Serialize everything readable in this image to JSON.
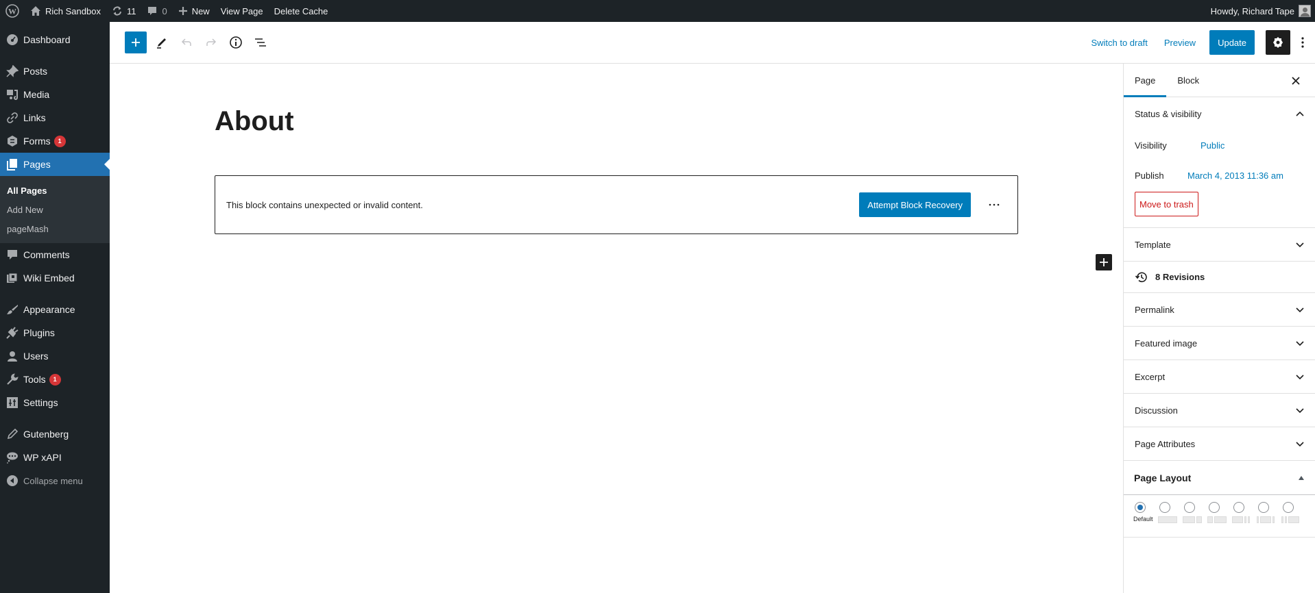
{
  "admin_bar": {
    "site_name": "Rich Sandbox",
    "updates_count": "11",
    "comments_count": "0",
    "new_label": "New",
    "view_page_label": "View Page",
    "delete_cache_label": "Delete Cache",
    "greeting": "Howdy, Richard Tape"
  },
  "sidebar": {
    "items": [
      {
        "label": "Dashboard",
        "icon": "dashboard-icon"
      },
      {
        "label": "Posts",
        "icon": "pin-icon"
      },
      {
        "label": "Media",
        "icon": "media-icon"
      },
      {
        "label": "Links",
        "icon": "link-icon"
      },
      {
        "label": "Forms",
        "icon": "forms-icon",
        "badge": "1"
      },
      {
        "label": "Pages",
        "icon": "pages-icon",
        "active": true
      },
      {
        "label": "Comments",
        "icon": "comment-icon"
      },
      {
        "label": "Wiki Embed",
        "icon": "wiki-icon"
      },
      {
        "label": "Appearance",
        "icon": "brush-icon"
      },
      {
        "label": "Plugins",
        "icon": "plug-icon"
      },
      {
        "label": "Users",
        "icon": "user-icon"
      },
      {
        "label": "Tools",
        "icon": "wrench-icon",
        "badge": "1"
      },
      {
        "label": "Settings",
        "icon": "settings-sliders-icon"
      },
      {
        "label": "Gutenberg",
        "icon": "pencil-icon"
      },
      {
        "label": "WP xAPI",
        "icon": "speech-bubble-icon"
      },
      {
        "label": "Collapse menu",
        "icon": "collapse-icon"
      }
    ],
    "pages_submenu": [
      "All Pages",
      "Add New",
      "pageMash"
    ]
  },
  "toolbar": {
    "switch_to_draft": "Switch to draft",
    "preview": "Preview",
    "update": "Update"
  },
  "editor": {
    "title": "About",
    "warning": "This block contains unexpected or invalid content.",
    "recover_label": "Attempt Block Recovery"
  },
  "panel": {
    "tabs": [
      "Page",
      "Block"
    ],
    "active_tab": "Page",
    "status_title": "Status & visibility",
    "visibility_label": "Visibility",
    "visibility_value": "Public",
    "publish_label": "Publish",
    "publish_value": "March 4, 2013 11:36 am",
    "trash_label": "Move to trash",
    "template_label": "Template",
    "revisions_label": "8 Revisions",
    "sections": [
      "Permalink",
      "Featured image",
      "Excerpt",
      "Discussion",
      "Page Attributes"
    ],
    "page_layout_title": "Page Layout",
    "layout_default_label": "Default",
    "layout_selected_index": 0
  },
  "colors": {
    "accent": "#007cba",
    "admin_active": "#2271b1",
    "admin_bg": "#1d2327",
    "badge": "#d63638",
    "danger": "#cc1818"
  }
}
